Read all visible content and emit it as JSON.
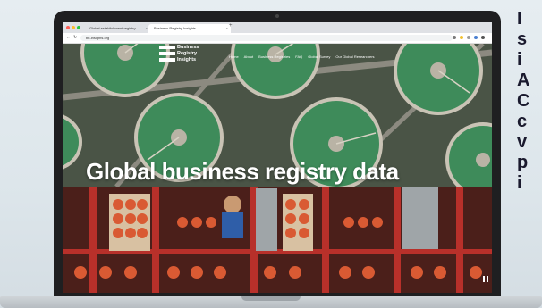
{
  "browser": {
    "tabs": [
      {
        "label": "Global establishment registry...",
        "active": false
      },
      {
        "label": "Business Registry Insights",
        "active": true
      }
    ],
    "new_tab_icon": "plus-icon",
    "url": "bri-insights.org",
    "window_dot_colors": [
      "#ff5f57",
      "#febc2e",
      "#28c840"
    ]
  },
  "site": {
    "logo_lines": [
      "Business",
      "Registry",
      "Insights"
    ],
    "nav": [
      "Home",
      "About",
      "Business Registries",
      "FAQ",
      "Global Survey",
      "Our Global Researchers"
    ],
    "hero_title": "Global business registry data",
    "video_control_icon": "pause-icon"
  },
  "side_text": [
    "I",
    "s",
    "i",
    "A",
    "C",
    "c",
    "v",
    "p",
    "i"
  ],
  "colors": {
    "tank_green": "#3e8b5a",
    "tank_rim": "#c9c3b5",
    "crate_red": "#b8302a",
    "tomato": "#d95a33",
    "background": "#e2e9ee"
  }
}
